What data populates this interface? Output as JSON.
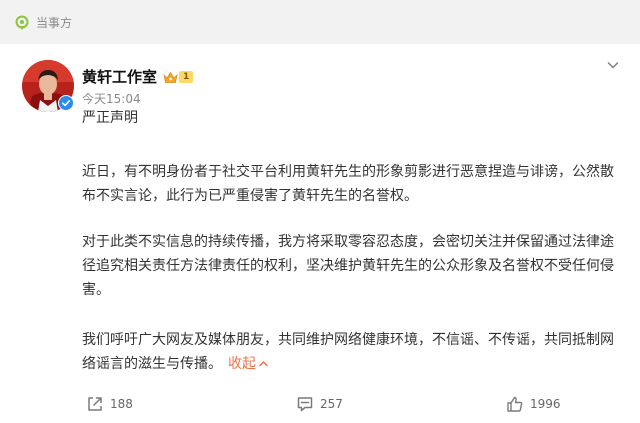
{
  "source_tag": {
    "label": "当事方"
  },
  "post": {
    "author": {
      "name": "黄轩工作室",
      "badge_level": "1"
    },
    "time": "今天15:04",
    "title": "严正声明",
    "paragraphs": [
      "近日，有不明身份者于社交平台利用黄轩先生的形象剪影进行恶意捏造与诽谤，公然散布不实言论，此行为已严重侵害了黄轩先生的名誉权。",
      "对于此类不实信息的持续传播，我方将采取零容忍态度，会密切关注并保留通过法律途径追究相关责任方法律责任的权利，坚决维护黄轩先生的公众形象及名誉权不受任何侵害。",
      "我们呼吁广大网友及媒体朋友，共同维护网络健康环境，不信谣、不传谣，共同抵制网络谣言的滋生与传播。"
    ],
    "collapse_label": "收起"
  },
  "actions": {
    "forward": {
      "icon": "share-icon",
      "count": "188"
    },
    "comment": {
      "icon": "comment-icon",
      "count": "257"
    },
    "like": {
      "icon": "like-icon",
      "count": "1996"
    }
  },
  "colors": {
    "accent_orange": "#eb7350",
    "tag_green": "#8cc63f",
    "verified_blue": "#2a8cf0",
    "badge_gold": "#ffd766"
  }
}
